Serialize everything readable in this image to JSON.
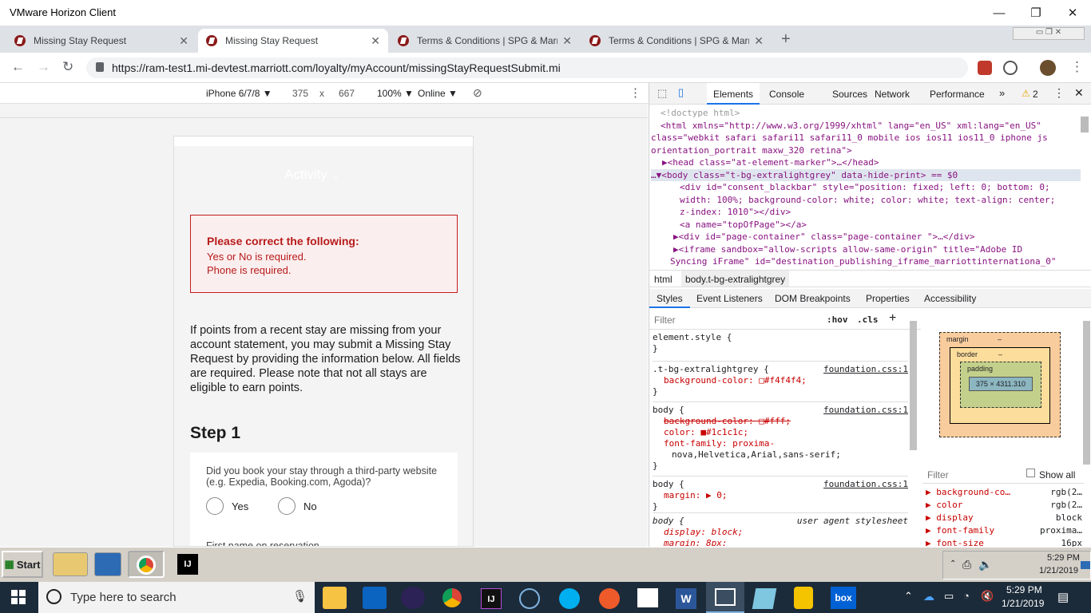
{
  "window": {
    "title": "VMware Horizon Client"
  },
  "tabs": [
    {
      "label": "Missing Stay Request"
    },
    {
      "label": "Missing Stay Request"
    },
    {
      "label": "Terms & Conditions | SPG & Marriott"
    },
    {
      "label": "Terms & Conditions | SPG & Marriott"
    }
  ],
  "address": {
    "url": "https://ram-test1.mi-devtest.marriott.com/loyalty/myAccount/missingStayRequestSubmit.mi"
  },
  "device": {
    "name": "iPhone 6/7/8 ▼",
    "width": "375",
    "x": "x",
    "height": "667",
    "zoom": "100% ▼",
    "network": "Online ▼"
  },
  "page": {
    "nav": "Activity",
    "error_title": "Please correct the following:",
    "error_1": "Yes or No is required.",
    "error_2": "Phone is required.",
    "intro": "If points from a recent stay are missing from your account statement, you may submit a Missing Stay Request by providing the information below. All fields are required. Please note that not all stays are eligible to earn points.",
    "step": "Step 1",
    "question": "Did you book your stay through a third-party website (e.g. Expedia, Booking.com, Agoda)?",
    "yes": "Yes",
    "no": "No",
    "next_label": "First name on reservation"
  },
  "devtools": {
    "tabs": [
      "Elements",
      "Console",
      "Sources",
      "Network",
      "Performance"
    ],
    "warn_count": "2",
    "dom": [
      "<!doctype html>",
      "<html xmlns=\"http://www.w3.org/1999/xhtml\" lang=\"en_US\" xml:lang=\"en_US\"",
      "class=\"webkit safari safari11 safari11_0 mobile ios ios11 ios11_0 iphone js",
      "orientation_portrait maxw_320 retina\">",
      "▶<head class=\"at-element-marker\">…</head>",
      "…▼<body class=\"t-bg-extralightgrey\" data-hide-print> == $0",
      "<div id=\"consent_blackbar\" style=\"position: fixed; left: 0; bottom: 0;",
      "width: 100%; background-color: white; color: white; text-align: center;",
      "z-index: 1010\"></div>",
      "<a name=\"topOfPage\"></a>",
      "▶<div id=\"page-container\" class=\"page-container  \">…</div>",
      "▶<iframe sandbox=\"allow-scripts allow-same-origin\" title=\"Adobe ID",
      "Syncing iFrame\" id=\"destination_publishing_iframe_marriottinternationa_0\""
    ],
    "crumbs": [
      "html",
      "body.t-bg-extralightgrey"
    ],
    "subtabs": [
      "Styles",
      "Event Listeners",
      "DOM Breakpoints",
      "Properties",
      "Accessibility"
    ],
    "filter": "Filter",
    "hov": ":hov",
    "cls": ".cls",
    "styles": [
      {
        "sel": "element.style {",
        "src": "",
        "props": [],
        "close": "}"
      },
      {
        "sel": ".t-bg-extralightgrey {",
        "src": "foundation.css:1",
        "props": [
          "background-color: □#f4f4f4;"
        ],
        "close": "}"
      },
      {
        "sel": "body {",
        "src": "foundation.css:1",
        "props": [
          "background-color: □#fff;",
          "color: ■#1c1c1c;",
          "font-family: proxima-",
          "    nova,Helvetica,Arial,sans-serif;"
        ],
        "close": "}"
      },
      {
        "sel": "body {",
        "src": "foundation.css:1",
        "props": [
          "margin: ▶ 0;"
        ],
        "close": "}"
      },
      {
        "sel": "body {",
        "src": "user agent stylesheet",
        "props": [
          "display: block;",
          "margin: 8px;"
        ],
        "close": ""
      }
    ],
    "box": {
      "margin": "margin",
      "border": "border",
      "padding": "padding",
      "dash": "–",
      "size": "375 × 4311.310"
    },
    "computed_filter": "Filter",
    "show_all": "Show all",
    "computed": [
      {
        "k": "background-co…",
        "v": "rgb(2…"
      },
      {
        "k": "color",
        "v": "rgb(2…"
      },
      {
        "k": "display",
        "v": "block"
      },
      {
        "k": "font-family",
        "v": "proxima…"
      },
      {
        "k": "font-size",
        "v": "16px"
      }
    ]
  },
  "taskbar_inner": {
    "start": "Start",
    "time": "5:29 PM",
    "date": "1/21/2019"
  },
  "taskbar": {
    "search": "Type here to search",
    "time": "5:29 PM",
    "date": "1/21/2019"
  }
}
